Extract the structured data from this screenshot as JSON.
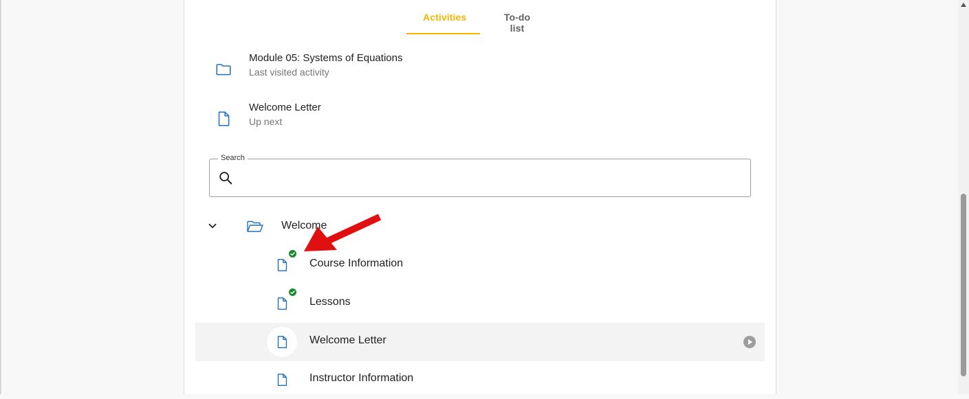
{
  "tabs": [
    {
      "label": "Activities",
      "active": true
    },
    {
      "label": "To-do list",
      "active": false
    }
  ],
  "quick_items": [
    {
      "title": "Module 05: Systems of Equations",
      "subtitle": "Last visited activity",
      "icon": "folder-icon"
    },
    {
      "title": "Welcome Letter",
      "subtitle": "Up next",
      "icon": "document-icon"
    }
  ],
  "search": {
    "label": "Search",
    "value": "",
    "icon": "search-icon"
  },
  "tree": {
    "folder": {
      "label": "Welcome",
      "expanded": true,
      "icon": "folder-open-icon"
    },
    "items": [
      {
        "label": "Course Information",
        "completed": true,
        "selected": false
      },
      {
        "label": "Lessons",
        "completed": true,
        "selected": false
      },
      {
        "label": "Welcome Letter",
        "completed": false,
        "selected": true
      },
      {
        "label": "Instructor Information",
        "completed": false,
        "selected": false
      }
    ]
  },
  "colors": {
    "accent": "#f4b400",
    "icon_blue": "#1f6fbf",
    "complete_green": "#1a8a2e",
    "annotation_red": "#e01010"
  }
}
